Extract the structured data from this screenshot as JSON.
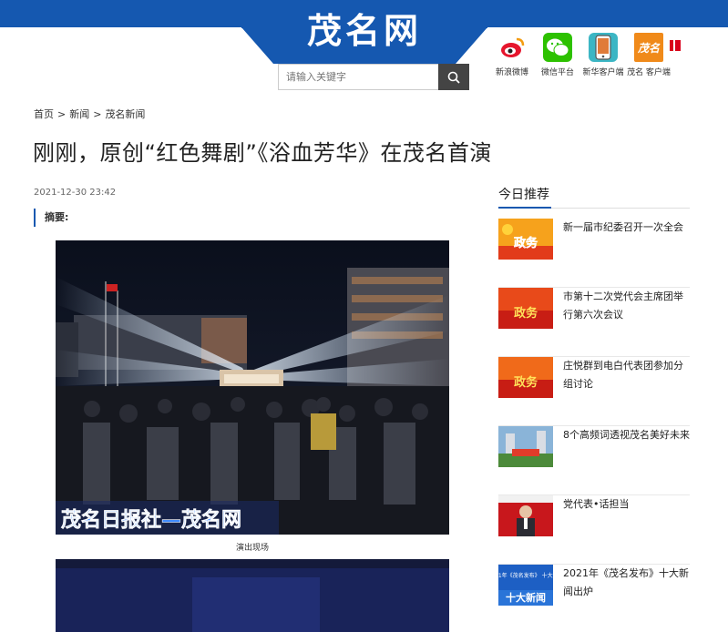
{
  "header": {
    "logo": "茂名网",
    "search_placeholder": "请输入关键字",
    "apps": [
      {
        "label": "新浪微博",
        "icon": "weibo-icon"
      },
      {
        "label": "微信平台",
        "icon": "wechat-icon"
      },
      {
        "label": "新华客户端",
        "icon": "xinhua-app-icon"
      },
      {
        "label": "茂名 客户端",
        "icon": "maoming-app-icon"
      }
    ]
  },
  "breadcrumb": [
    "首页",
    "新闻",
    "茂名新闻"
  ],
  "article": {
    "title": "刚刚，原创“红色舞剧”《浴血芳华》在茂名首演",
    "date": "2021-12-30 23:42",
    "summary_label": "摘要:",
    "photo_watermark": "茂名日报社—茂名网",
    "photo_caption": "演出现场"
  },
  "sidebar": {
    "title": "今日推荐",
    "items": [
      {
        "text": "新一届市纪委召开一次全会",
        "thumb": "政务"
      },
      {
        "text": "市第十二次党代会主席团举行第六次会议",
        "thumb": "政务"
      },
      {
        "text": "庄悦群到电白代表团参加分组讨论",
        "thumb": "政务"
      },
      {
        "text": "8个高频词透视茂名美好未来",
        "thumb": ""
      },
      {
        "text": "党代表•话担当",
        "thumb": ""
      },
      {
        "text": "2021年《茂名发布》十大新闻出炉",
        "thumb": "2021年《茂名发布》 十大新闻"
      }
    ]
  },
  "colors": {
    "brand_blue": "#1558b0",
    "accent_red": "#d9001b"
  }
}
